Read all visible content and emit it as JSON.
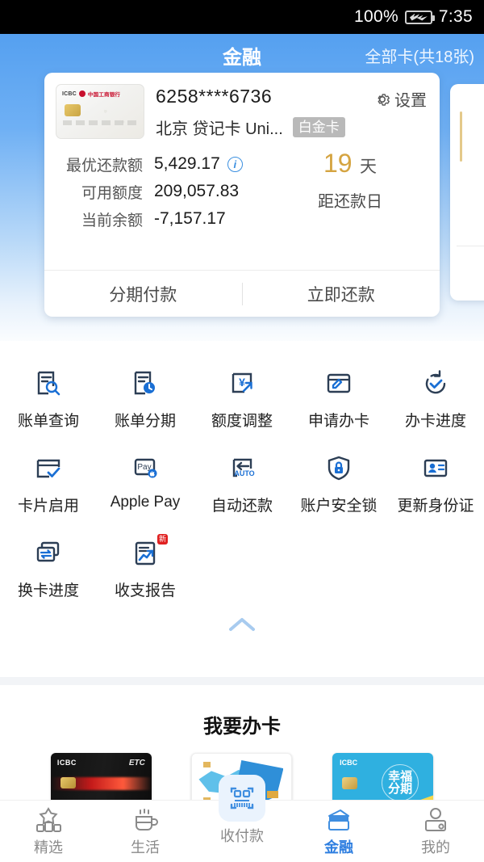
{
  "statusbar": {
    "battery_percent": "100%",
    "time": "7:35",
    "battery_icon": "charging-battery-icon"
  },
  "appbar": {
    "title": "金融",
    "all_cards": "全部卡(共18张)"
  },
  "card": {
    "number": "6258****6736",
    "description": "北京 贷记卡 Uni...",
    "badge": "白金卡",
    "settings_label": "设置",
    "rows": [
      {
        "label": "最优还款额",
        "value": "5,429.17",
        "has_info": true
      },
      {
        "label": "可用额度",
        "value": "209,057.83",
        "has_info": false
      },
      {
        "label": "当前余额",
        "value": "-7,157.17",
        "has_info": false
      }
    ],
    "due": {
      "days": "19",
      "unit": "天",
      "caption": "距还款日",
      "color": "#d5a441"
    },
    "actions": {
      "installment": "分期付款",
      "repay": "立即还款"
    }
  },
  "quick_actions": [
    {
      "label": "账单查询",
      "icon": "bill-search-icon"
    },
    {
      "label": "账单分期",
      "icon": "bill-installment-icon"
    },
    {
      "label": "额度调整",
      "icon": "credit-limit-icon"
    },
    {
      "label": "申请办卡",
      "icon": "apply-card-icon"
    },
    {
      "label": "办卡进度",
      "icon": "card-progress-icon"
    },
    {
      "label": "卡片启用",
      "icon": "card-activate-icon"
    },
    {
      "label": "Apple Pay",
      "icon": "apple-pay-icon"
    },
    {
      "label": "自动还款",
      "icon": "auto-repay-icon"
    },
    {
      "label": "账户安全锁",
      "icon": "account-lock-icon"
    },
    {
      "label": "更新身份证",
      "icon": "update-id-icon"
    },
    {
      "label": "换卡进度",
      "icon": "card-replace-icon"
    },
    {
      "label": "收支报告",
      "icon": "income-report-icon",
      "badge": "新"
    }
  ],
  "collapse": {
    "icon": "chevron-up-icon"
  },
  "promo": {
    "title": "我要办卡",
    "cards": [
      {
        "name": "etc-card",
        "brand": "ICBC",
        "tag": "ETC"
      },
      {
        "name": "landscape-card",
        "brand": "",
        "tag": ""
      },
      {
        "name": "happy-installment-card",
        "brand": "ICBC",
        "tag": "幸福分期"
      }
    ]
  },
  "bottom_nav": {
    "items": [
      {
        "label": "精选",
        "icon": "star-blocks-icon",
        "active": false
      },
      {
        "label": "生活",
        "icon": "cup-icon",
        "active": false
      },
      {
        "label": "收付款",
        "icon": "scan-barcode-icon",
        "active": false
      },
      {
        "label": "金融",
        "icon": "wallet-card-icon",
        "active": true
      },
      {
        "label": "我的",
        "icon": "profile-icon",
        "active": false
      }
    ],
    "active_color": "#2f7fe0"
  }
}
